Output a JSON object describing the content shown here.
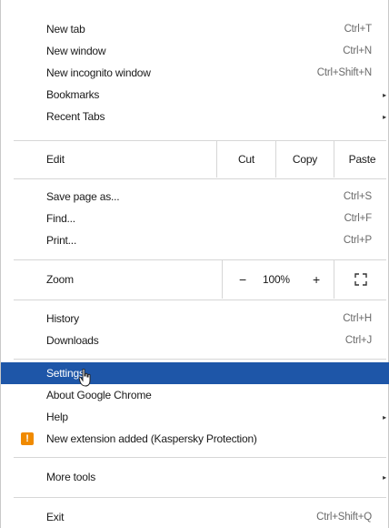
{
  "menu": {
    "group1": [
      {
        "label": "New tab",
        "shortcut": "Ctrl+T"
      },
      {
        "label": "New window",
        "shortcut": "Ctrl+N"
      },
      {
        "label": "New incognito window",
        "shortcut": "Ctrl+Shift+N"
      },
      {
        "label": "Bookmarks",
        "submenu_arrow": "▸"
      },
      {
        "label": "Recent Tabs",
        "submenu_arrow": "▸"
      }
    ],
    "edit": {
      "label": "Edit",
      "cut": "Cut",
      "copy": "Copy",
      "paste": "Paste"
    },
    "group2": [
      {
        "label": "Save page as...",
        "shortcut": "Ctrl+S"
      },
      {
        "label": "Find...",
        "shortcut": "Ctrl+F"
      },
      {
        "label": "Print...",
        "shortcut": "Ctrl+P"
      }
    ],
    "zoom": {
      "label": "Zoom",
      "minus": "−",
      "value": "100%",
      "plus": "+",
      "fullscreen_icon": "fullscreen-icon"
    },
    "group3": [
      {
        "label": "History",
        "shortcut": "Ctrl+H"
      },
      {
        "label": "Downloads",
        "shortcut": "Ctrl+J"
      }
    ],
    "group4": [
      {
        "label": "Settings",
        "highlighted": true
      },
      {
        "label": "About Google Chrome"
      },
      {
        "label": "Help",
        "submenu_arrow": "▸"
      },
      {
        "label": "New extension added (Kaspersky Protection)",
        "icon": "warning-icon",
        "icon_glyph": "!"
      }
    ],
    "more_tools": {
      "label": "More tools",
      "submenu_arrow": "▸"
    },
    "exit": {
      "label": "Exit",
      "shortcut": "Ctrl+Shift+Q"
    }
  },
  "colors": {
    "highlight": "#1e56a8",
    "warning": "#f08a00"
  }
}
